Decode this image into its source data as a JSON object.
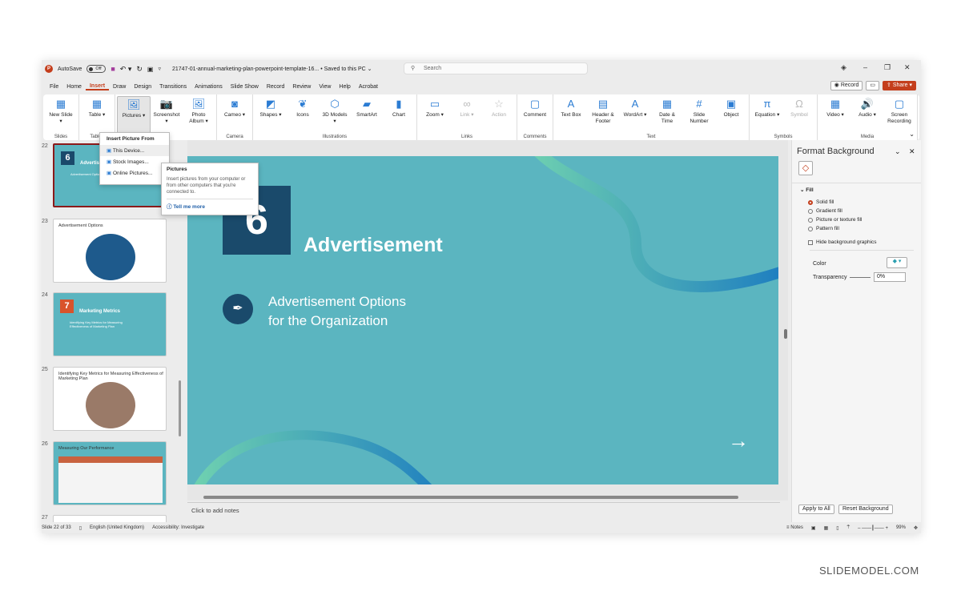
{
  "titlebar": {
    "autosave": "AutoSave",
    "autosave_state": "Off",
    "filename": "21747-01-annual-marketing-plan-powerpoint-template-16... • Saved to this PC ⌄",
    "search_placeholder": "Search"
  },
  "menu": {
    "tabs": [
      "File",
      "Home",
      "Insert",
      "Draw",
      "Design",
      "Transitions",
      "Animations",
      "Slide Show",
      "Record",
      "Review",
      "View",
      "Help",
      "Acrobat"
    ],
    "active": "Insert",
    "record": "Record",
    "share": "Share"
  },
  "ribbon": {
    "groups": [
      {
        "label": "Slides",
        "buttons": [
          {
            "label": "New Slide ▾",
            "icon": "new-slide-icon",
            "g": "▦"
          }
        ]
      },
      {
        "label": "Tables",
        "buttons": [
          {
            "label": "Table ▾",
            "icon": "table-icon",
            "g": "▦"
          }
        ]
      },
      {
        "label": "",
        "buttons": [
          {
            "label": "Pictures ▾",
            "icon": "pictures-icon",
            "g": "🖼",
            "sel": true
          },
          {
            "label": "Screenshot ▾",
            "icon": "screenshot-icon",
            "g": "📷"
          },
          {
            "label": "Photo Album ▾",
            "icon": "photo-album-icon",
            "g": "🖼"
          }
        ]
      },
      {
        "label": "Camera",
        "buttons": [
          {
            "label": "Cameo ▾",
            "icon": "cameo-icon",
            "g": "◙"
          }
        ]
      },
      {
        "label": "Illustrations",
        "buttons": [
          {
            "label": "Shapes ▾",
            "icon": "shapes-icon",
            "g": "◩"
          },
          {
            "label": "Icons",
            "icon": "icons-icon",
            "g": "❦"
          },
          {
            "label": "3D Models ▾",
            "icon": "3d-models-icon",
            "g": "⬡"
          },
          {
            "label": "SmartArt",
            "icon": "smartart-icon",
            "g": "▰"
          },
          {
            "label": "Chart",
            "icon": "chart-icon",
            "g": "▮"
          }
        ]
      },
      {
        "label": "Links",
        "buttons": [
          {
            "label": "Zoom ▾",
            "icon": "zoom-icon",
            "g": "▭"
          },
          {
            "label": "Link ▾",
            "icon": "link-icon",
            "g": "∞",
            "dis": true
          },
          {
            "label": "Action",
            "icon": "action-icon",
            "g": "☆",
            "dis": true
          }
        ]
      },
      {
        "label": "Comments",
        "buttons": [
          {
            "label": "Comment",
            "icon": "comment-icon",
            "g": "▢"
          }
        ]
      },
      {
        "label": "Text",
        "buttons": [
          {
            "label": "Text Box",
            "icon": "text-box-icon",
            "g": "A"
          },
          {
            "label": "Header & Footer",
            "icon": "header-footer-icon",
            "g": "▤"
          },
          {
            "label": "WordArt ▾",
            "icon": "wordart-icon",
            "g": "A"
          },
          {
            "label": "Date & Time",
            "icon": "date-time-icon",
            "g": "▦"
          },
          {
            "label": "Slide Number",
            "icon": "slide-number-icon",
            "g": "#"
          },
          {
            "label": "Object",
            "icon": "object-icon",
            "g": "▣"
          }
        ]
      },
      {
        "label": "Symbols",
        "buttons": [
          {
            "label": "Equation ▾",
            "icon": "equation-icon",
            "g": "π"
          },
          {
            "label": "Symbol",
            "icon": "symbol-icon",
            "g": "Ω",
            "dis": true
          }
        ]
      },
      {
        "label": "Media",
        "buttons": [
          {
            "label": "Video ▾",
            "icon": "video-icon",
            "g": "▦"
          },
          {
            "label": "Audio ▾",
            "icon": "audio-icon",
            "g": "🔊"
          },
          {
            "label": "Screen Recording",
            "icon": "screen-recording-icon",
            "g": "▢"
          }
        ]
      }
    ]
  },
  "dropdown": {
    "title": "Insert Picture From",
    "items": [
      "This Device...",
      "Stock Images...",
      "Online Pictures..."
    ]
  },
  "tooltip": {
    "title": "Pictures",
    "body": "Insert pictures from your computer or from other computers that you're connected to.",
    "link": "Tell me more"
  },
  "thumbnails": [
    {
      "num": "22",
      "title": "Advertisement",
      "num_badge": "6",
      "sub": "Advertisement Options for the Organization"
    },
    {
      "num": "23",
      "title": "Advertisement Options"
    },
    {
      "num": "24",
      "title": "Marketing Metrics",
      "num_badge": "7",
      "sub": "Identifying Key Metrics for Measuring Effectiveness of Marketing Plan"
    },
    {
      "num": "25",
      "title": "Identifying Key Metrics for Measuring Effectiveness of Marketing Plan"
    },
    {
      "num": "26",
      "title": "Measuring Our Performance"
    },
    {
      "num": "27"
    }
  ],
  "slide": {
    "number": "6",
    "title": "Advertisement",
    "subtitle_line1": "Advertisement Options",
    "subtitle_line2": "for the Organization",
    "bg_color": "#5bb5c0"
  },
  "notes": {
    "placeholder": "Click to add notes"
  },
  "pane": {
    "title": "Format Background",
    "section": "Fill",
    "options": [
      "Solid fill",
      "Gradient fill",
      "Picture or texture fill",
      "Pattern fill"
    ],
    "selected": "Solid fill",
    "checkbox": "Hide background graphics",
    "color_label": "Color",
    "transparency_label": "Transparency",
    "transparency_value": "0%",
    "apply_all": "Apply to All",
    "reset": "Reset Background"
  },
  "status": {
    "slide": "Slide 22 of 33",
    "language": "English (United Kingdom)",
    "accessibility": "Accessibility: Investigate",
    "notes": "Notes",
    "zoom": "99%"
  },
  "watermark": "SLIDEMODEL.COM",
  "colors": {
    "accent": "#c43e1c",
    "teal": "#5bb5c0",
    "navy": "#1a4a6b"
  }
}
